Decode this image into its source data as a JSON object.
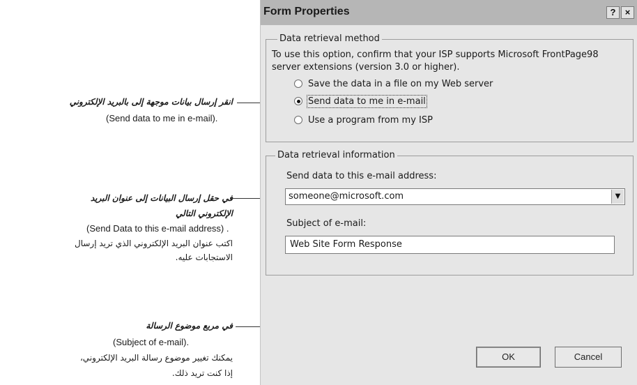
{
  "dialog": {
    "title": "Form Properties",
    "help_label": "?",
    "close_label": "×",
    "retrieval_group": {
      "legend": "Data retrieval method",
      "description_line1": "To use this option, confirm that your ISP supports Microsoft FrontPage98",
      "description_line2": "server extensions (version 3.0 or higher).",
      "options": [
        {
          "label": "Save the data in a file on my Web server",
          "selected": false
        },
        {
          "label": "Send data to me in e-mail",
          "selected": true
        },
        {
          "label": "Use a program from my ISP",
          "selected": false
        }
      ]
    },
    "info_group": {
      "legend": "Data retrieval information",
      "email_label": "Send data to this e-mail address:",
      "email_value": "someone@microsoft.com",
      "subject_label": "Subject of e-mail:",
      "subject_value": "Web Site Form Response"
    },
    "ok_label": "OK",
    "cancel_label": "Cancel"
  },
  "callouts": [
    {
      "bold": "انقر إرسال بيانات موجهة إلى بالبريد الإلكتروني",
      "english": "(Send data to me in e-mail)."
    },
    {
      "bold_line1": "في حقل إرسال البيانات إلى عنوان البريد",
      "bold_line2": "الإلكتروني التالي",
      "english": "(Send Data to this e-mail address) .",
      "body_line1": "اكتب عنوان البريد الإلكتروني الذي تريد إرسال",
      "body_line2": "الاستجابات عليه."
    },
    {
      "bold": "في مربع موضوع الرسالة",
      "english": "(Subject of e-mail).",
      "body_line1": "يمكنك تغيير موضوع رسالة البريد الإلكتروني،",
      "body_line2": "إذا كنت تريد ذلك."
    }
  ]
}
